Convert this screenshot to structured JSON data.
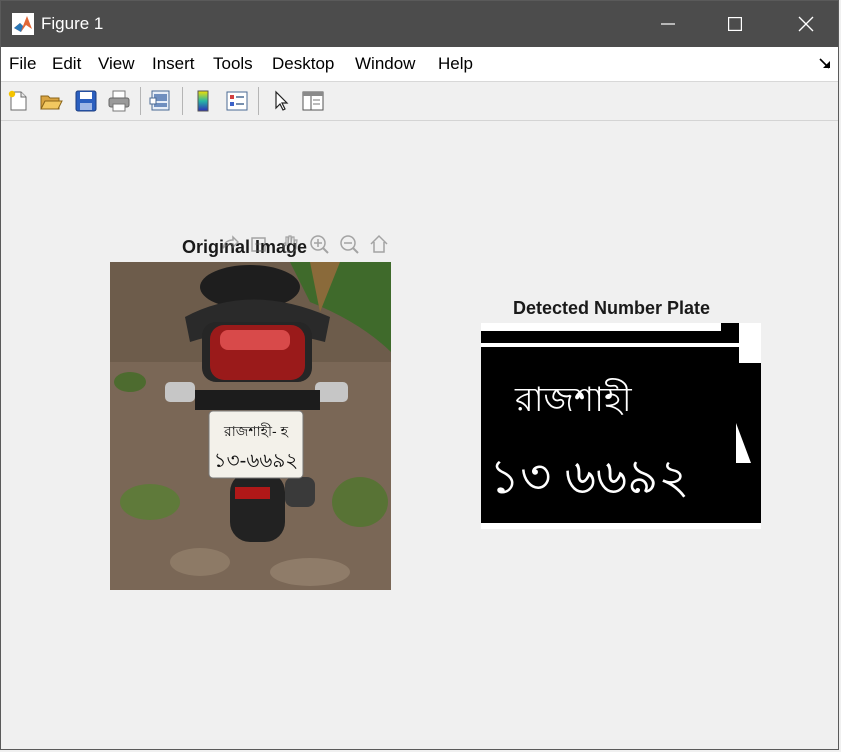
{
  "window": {
    "title": "Figure 1"
  },
  "menu": [
    "File",
    "Edit",
    "View",
    "Insert",
    "Tools",
    "Desktop",
    "Window",
    "Help"
  ],
  "toolbar": {
    "buttons": [
      "new-figure-icon",
      "open-file-icon",
      "save-icon",
      "print-icon",
      "link-plot-icon",
      "colorbar-icon",
      "legend-icon",
      "edit-plot-icon",
      "property-inspector-icon"
    ]
  },
  "axes": [
    {
      "title": "Original Image",
      "image": "motorcycle rear with number plate"
    },
    {
      "title": "Detected Number Plate",
      "image": "binarized number plate"
    }
  ],
  "plate": {
    "line1": "রাজশাহী- হ",
    "line2": "১৩-৬৬৯২",
    "bw_line1": "রাজশাহী",
    "bw_line2": "১৩ ৬৬৯২"
  },
  "axes_toolbar": [
    "export-icon",
    "brush-icon",
    "pan-icon",
    "zoom-in-icon",
    "zoom-out-icon",
    "home-icon"
  ]
}
